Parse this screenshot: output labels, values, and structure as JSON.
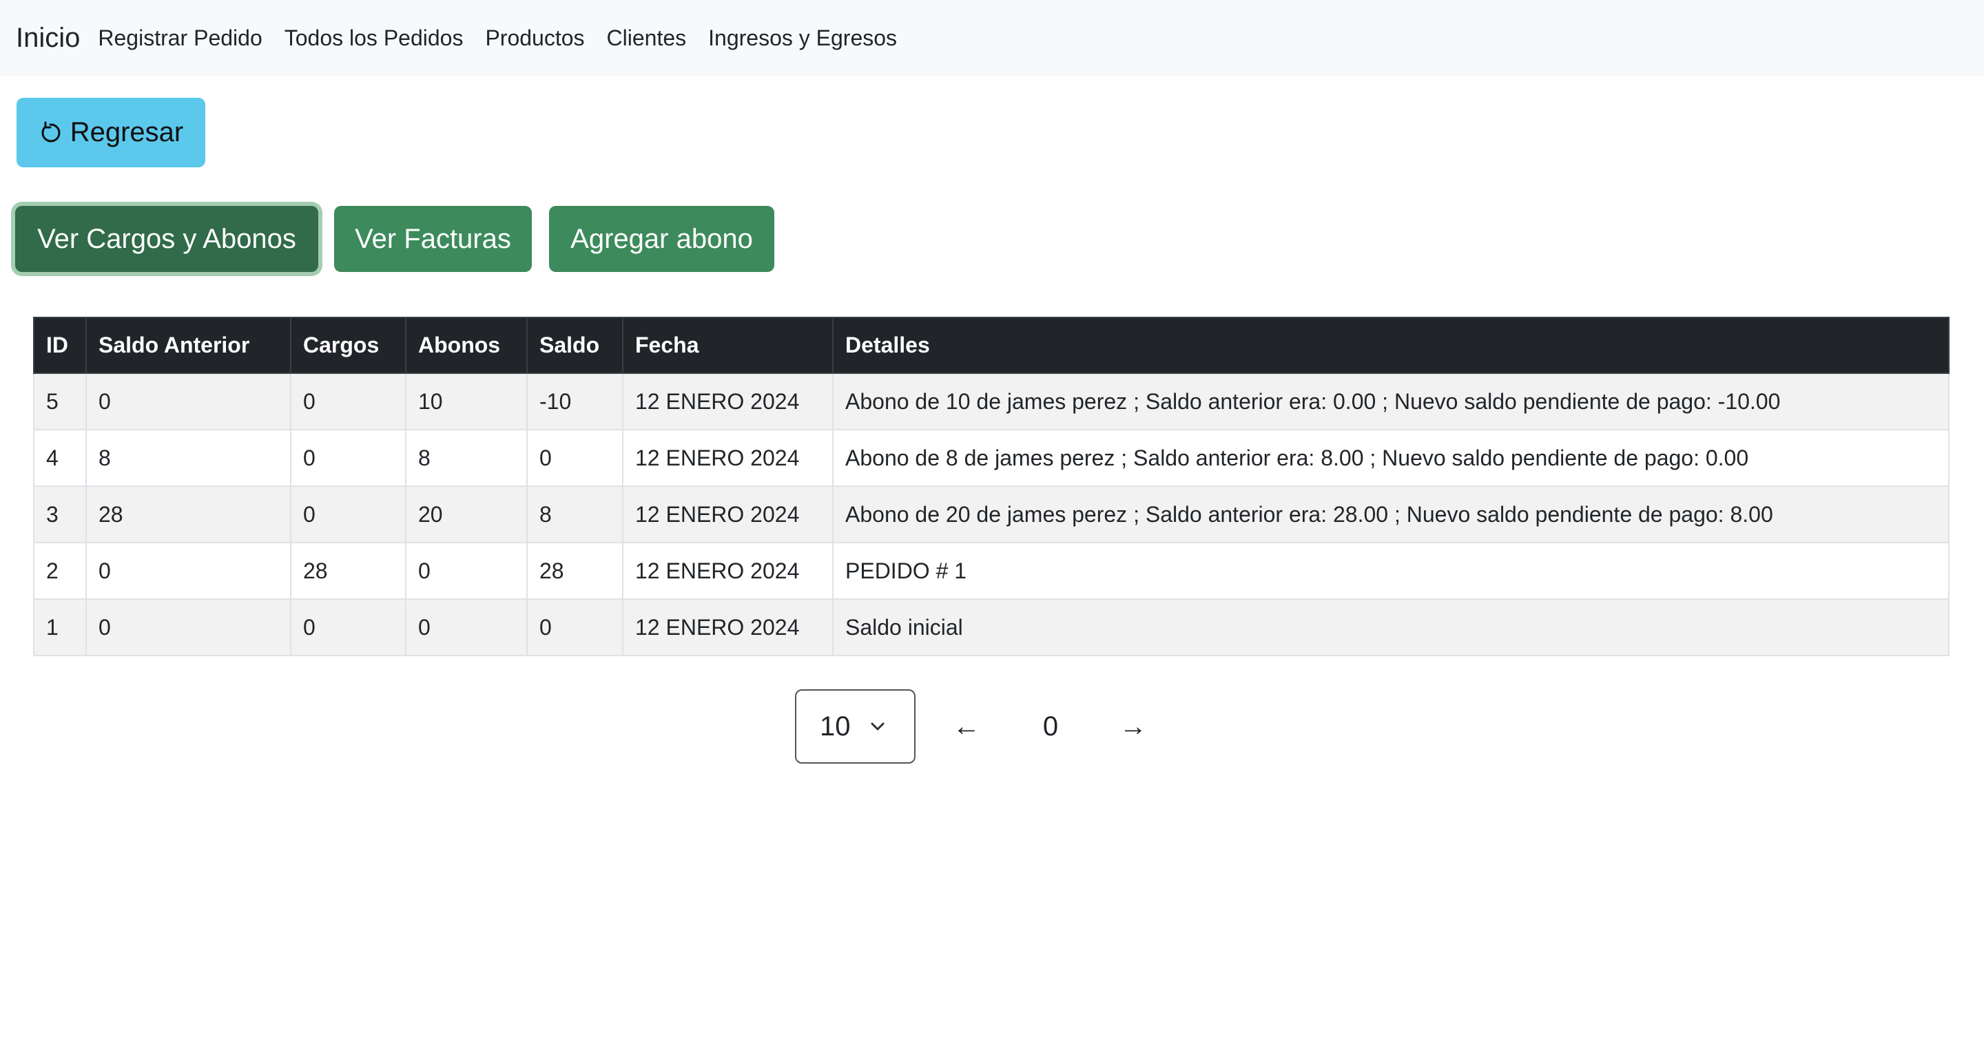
{
  "navbar": {
    "brand": "Inicio",
    "links": [
      "Registrar Pedido",
      "Todos los Pedidos",
      "Productos",
      "Clientes",
      "Ingresos y Egresos"
    ]
  },
  "actions": {
    "back_label": "Regresar",
    "back_icon": "refresh-icon",
    "tabs": [
      "Ver Cargos y Abonos",
      "Ver Facturas",
      "Agregar abono"
    ],
    "active_tab": "Ver Cargos y Abonos"
  },
  "table": {
    "headers": [
      "ID",
      "Saldo Anterior",
      "Cargos",
      "Abonos",
      "Saldo",
      "Fecha",
      "Detalles"
    ],
    "rows": [
      [
        "5",
        "0",
        "0",
        "10",
        "-10",
        "12 ENERO 2024",
        "Abono de 10 de james perez ; Saldo anterior era: 0.00 ; Nuevo saldo pendiente de pago: -10.00"
      ],
      [
        "4",
        "8",
        "0",
        "8",
        "0",
        "12 ENERO 2024",
        "Abono de 8 de james perez ; Saldo anterior era: 8.00 ; Nuevo saldo pendiente de pago: 0.00"
      ],
      [
        "3",
        "28",
        "0",
        "20",
        "8",
        "12 ENERO 2024",
        "Abono de 20 de james perez ; Saldo anterior era: 28.00 ; Nuevo saldo pendiente de pago: 8.00"
      ],
      [
        "2",
        "0",
        "28",
        "0",
        "28",
        "12 ENERO 2024",
        "PEDIDO # 1"
      ],
      [
        "1",
        "0",
        "0",
        "0",
        "0",
        "12 ENERO 2024",
        "Saldo inicial"
      ]
    ]
  },
  "pagination": {
    "page_size": "10",
    "prev": "←",
    "current_page": "0",
    "next": "→"
  },
  "colors": {
    "navbar_bg": "#f8f9fa",
    "back_button": "#5bc8ec",
    "green_button": "#3d8a5c",
    "active_button": "#316b49",
    "table_header": "#212529",
    "striped_row": "#f2f2f2"
  }
}
